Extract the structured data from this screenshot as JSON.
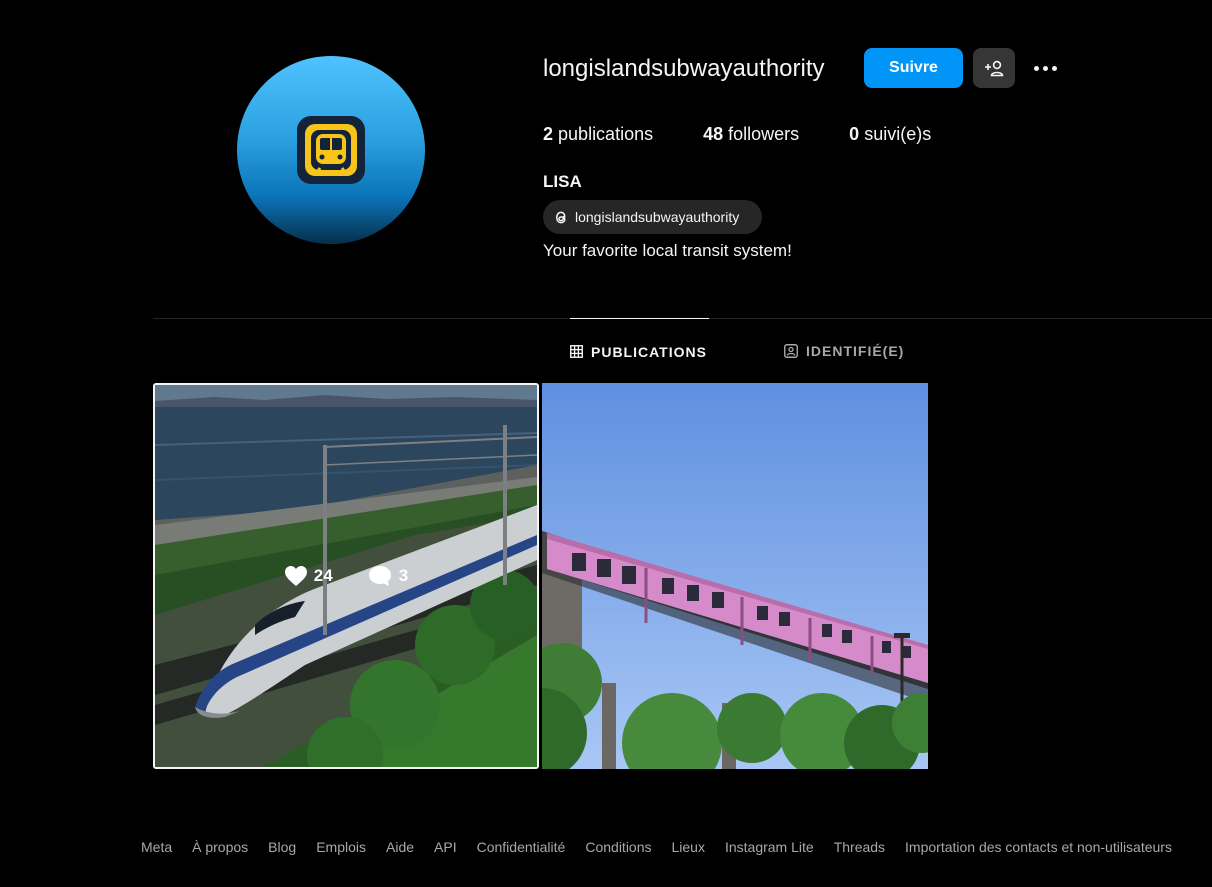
{
  "profile": {
    "username": "longislandsubwayauthority",
    "follow_label": "Suivre",
    "stats": {
      "posts_count": "2",
      "posts_label": "publications",
      "followers_count": "48",
      "followers_label": "followers",
      "following_count": "0",
      "following_label": "suivi(e)s"
    },
    "full_name": "LISA",
    "threads_handle": "longislandsubwayauthority",
    "bio": "Your favorite local transit system!"
  },
  "tabs": [
    {
      "label": "PUBLICATIONS",
      "icon": "grid-icon",
      "active": true
    },
    {
      "label": "IDENTIFIÉ(E)",
      "icon": "tagged-icon",
      "active": false
    }
  ],
  "posts": [
    {
      "likes": "24",
      "comments": "3",
      "subject": "white-bullet-train-by-sea"
    },
    {
      "subject": "pink-elevated-train"
    }
  ],
  "footer": {
    "links": [
      "Meta",
      "À propos",
      "Blog",
      "Emplois",
      "Aide",
      "API",
      "Confidentialité",
      "Conditions",
      "Lieux",
      "Instagram Lite",
      "Threads",
      "Importation des contacts et non-utilisateurs"
    ]
  },
  "colors": {
    "accent": "#0095f6",
    "background": "#000000",
    "muted": "#a8a8a8"
  }
}
